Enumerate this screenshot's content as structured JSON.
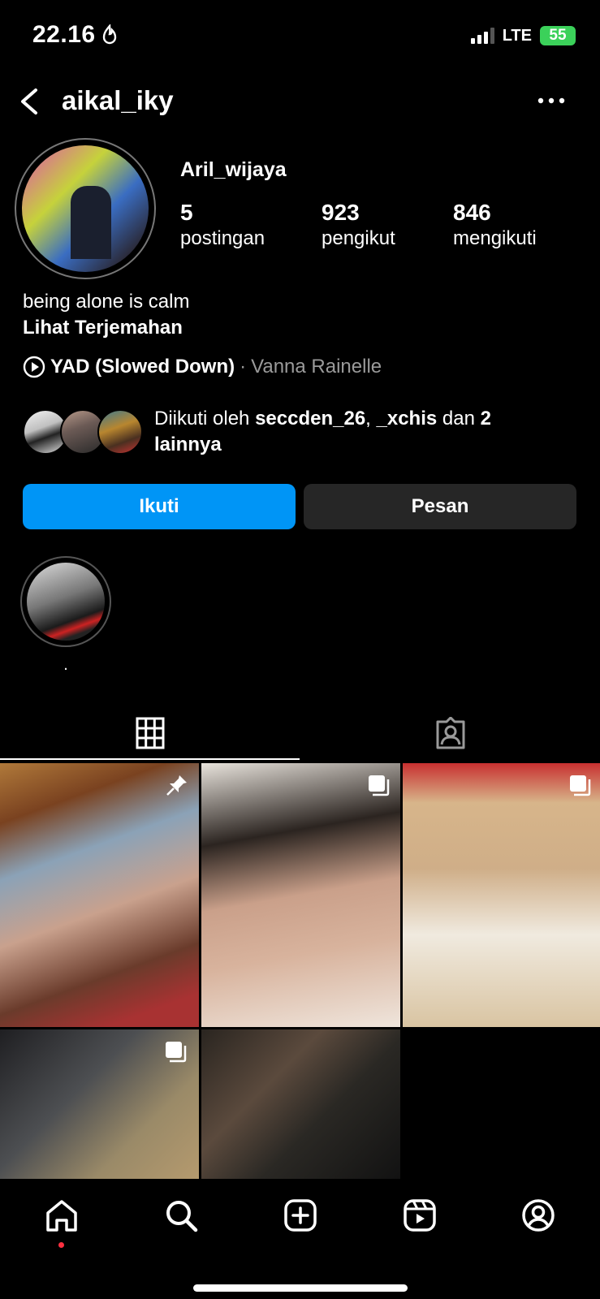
{
  "status_bar": {
    "time": "22.16",
    "network": "LTE",
    "battery": "55"
  },
  "header": {
    "username": "aikal_iky"
  },
  "profile": {
    "display_name": "Aril_wijaya",
    "stats": [
      {
        "value": "5",
        "label": "postingan"
      },
      {
        "value": "923",
        "label": "pengikut"
      },
      {
        "value": "846",
        "label": "mengikuti"
      }
    ],
    "bio": "being alone is calm",
    "translate_label": "Lihat Terjemahan",
    "music": {
      "title": "YAD (Slowed Down)",
      "separator": " · ",
      "artist": "Vanna Rainelle"
    },
    "mutuals": {
      "prefix": "Diikuti oleh ",
      "user1": "seccden_26",
      "comma": ", ",
      "user2": "_xchis",
      "middle": " dan ",
      "others": "2 lainnya"
    }
  },
  "actions": {
    "follow_label": "Ikuti",
    "message_label": "Pesan"
  },
  "highlight": {
    "label": "."
  },
  "tabs": [
    {
      "icon": "grid-icon"
    },
    {
      "icon": "tagged-icon"
    }
  ],
  "posts": [
    {
      "icon": "pin-icon"
    },
    {
      "icon": "carousel-icon"
    },
    {
      "icon": "carousel-icon"
    },
    {
      "icon": "carousel-icon"
    },
    {
      "icon": ""
    }
  ],
  "bottom_nav": [
    "home-icon",
    "search-icon",
    "create-icon",
    "reels-icon",
    "profile-icon"
  ],
  "colors": {
    "primary": "#0095f6",
    "secondary_button": "#262626",
    "notification_dot": "#ff3040",
    "battery": "#3bd15a"
  }
}
